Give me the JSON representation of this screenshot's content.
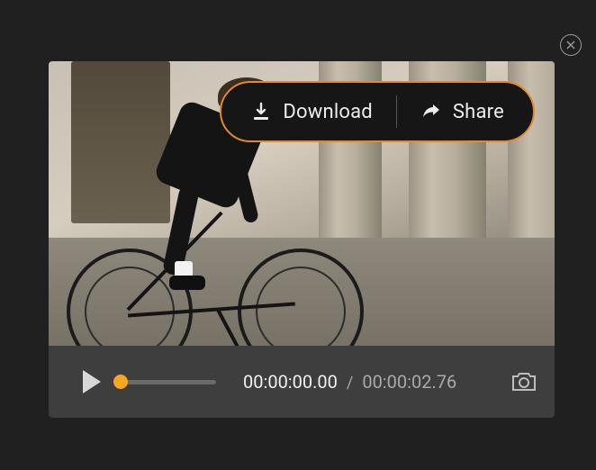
{
  "actions": {
    "download_label": "Download",
    "share_label": "Share"
  },
  "player": {
    "current_time": "00:00:00.00",
    "separator": "/",
    "total_time": "00:00:02.76"
  }
}
